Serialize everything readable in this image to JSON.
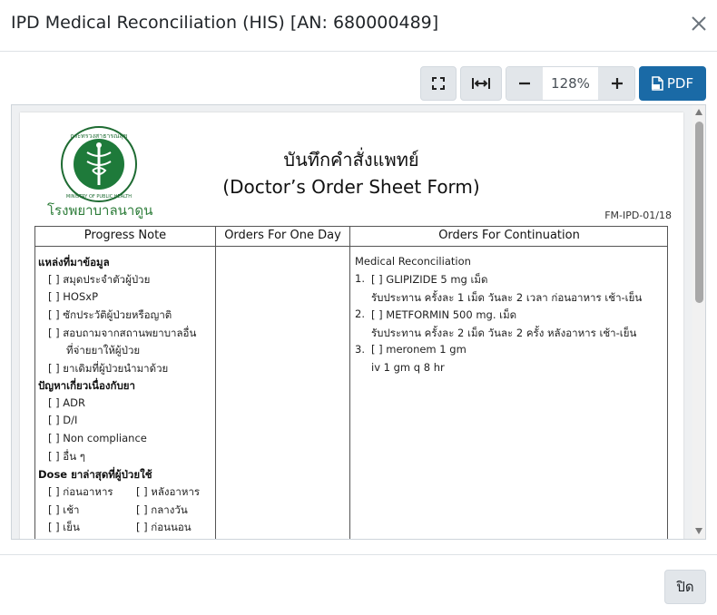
{
  "modal": {
    "title": "IPD Medical Reconciliation (HIS) [AN: 680000489]",
    "footer_close_label": "ปิด"
  },
  "toolbar": {
    "zoom_value": "128%",
    "pdf_label": "PDF"
  },
  "document": {
    "hospital_name": "โรงพยาบาลนาดูน",
    "logo_text_top": "กระทรวงสาธารณสุข",
    "logo_text_bottom": "MINISTRY OF PUBLIC HEALTH",
    "title_th": "บันทึกคำสั่งแพทย์",
    "title_en": "(Doctor’s Order Sheet Form)",
    "form_code": "FM-IPD-01/18",
    "columns": [
      "Progress Note",
      "Orders For One Day",
      "Orders For Continuation"
    ],
    "progress_note": {
      "source_heading": "แหล่งที่มาข้อมูล",
      "source_items": [
        "[  ] สมุดประจำตัวผู้ป่วย",
        "[  ] HOSxP",
        "[  ] ซักประวัติผู้ป่วยหรือญาติ",
        "[  ] สอบถามจากสถานพยาบาลอื่น",
        "ที่จ่ายยาให้ผู้ป่วย",
        "[  ] ยาเดิมที่ผู้ป่วยนำมาด้วย"
      ],
      "problem_heading": "ปัญหาเกี่ยวเนื่องกับยา",
      "problem_items": [
        "[  ] ADR",
        "[  ] D/I",
        "[  ] Non compliance",
        "[  ] อื่น ๆ"
      ],
      "dose_heading": "Dose ยาล่าสุดที่ผู้ป่วยใช้",
      "dose_left": [
        "[  ] ก่อนอาหาร",
        "[  ] เช้า",
        "[  ] เย็น"
      ],
      "dose_right": [
        "[  ] หลังอาหาร",
        "[  ] กลางวัน",
        "[  ] ก่อนนอน"
      ]
    },
    "continuation": {
      "heading": "Medical Reconciliation",
      "items": [
        {
          "num": "1.",
          "line1": "[  ] GLIPIZIDE 5 mg เม็ด",
          "line2": "รับประทาน ครั้งละ 1 เม็ด วันละ 2 เวลา ก่อนอาหาร เช้า-เย็น"
        },
        {
          "num": "2.",
          "line1": "[  ] METFORMIN 500 mg. เม็ด",
          "line2": "รับประทาน ครั้งละ 2 เม็ด วันละ 2 ครั้ง หลังอาหาร เช้า-เย็น"
        },
        {
          "num": "3.",
          "line1": "[  ] meronem 1 gm",
          "line2": "iv 1 gm q 8 hr"
        }
      ]
    }
  }
}
